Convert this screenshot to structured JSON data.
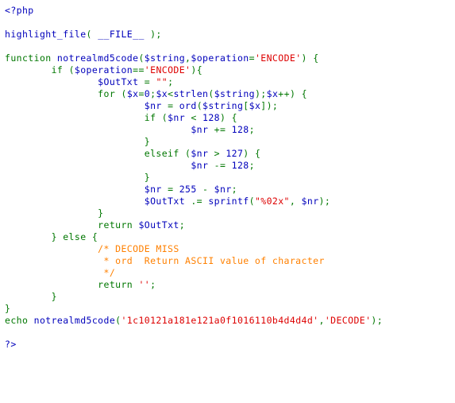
{
  "document": {
    "type": "php-source-highlight",
    "language": "PHP",
    "background_color": "#FFFFFF"
  },
  "palette": {
    "html": "#0000BB",
    "default": "#0000BB",
    "keyword": "#007700",
    "string": "#DD0000",
    "comment": "#FF8000"
  },
  "code": {
    "lines": [
      {
        "tokens": [
          {
            "t": "html",
            "s": "<?php"
          }
        ]
      },
      {
        "tokens": []
      },
      {
        "tokens": [
          {
            "t": "default",
            "s": "highlight_file"
          },
          {
            "t": "keyword",
            "s": "( "
          },
          {
            "t": "default",
            "s": "__FILE__ "
          },
          {
            "t": "keyword",
            "s": ");"
          }
        ]
      },
      {
        "tokens": []
      },
      {
        "tokens": [
          {
            "t": "keyword",
            "s": "function "
          },
          {
            "t": "default",
            "s": "notrealmd5code"
          },
          {
            "t": "keyword",
            "s": "("
          },
          {
            "t": "default",
            "s": "$string"
          },
          {
            "t": "keyword",
            "s": ","
          },
          {
            "t": "default",
            "s": "$operation"
          },
          {
            "t": "keyword",
            "s": "="
          },
          {
            "t": "string",
            "s": "'ENCODE'"
          },
          {
            "t": "keyword",
            "s": ") {"
          }
        ]
      },
      {
        "tokens": [
          {
            "t": "keyword",
            "s": "        if "
          },
          {
            "t": "keyword",
            "s": "("
          },
          {
            "t": "default",
            "s": "$operation"
          },
          {
            "t": "keyword",
            "s": "=="
          },
          {
            "t": "string",
            "s": "'ENCODE'"
          },
          {
            "t": "keyword",
            "s": "){"
          }
        ]
      },
      {
        "tokens": [
          {
            "t": "default",
            "s": "                $OutTxt "
          },
          {
            "t": "keyword",
            "s": "= "
          },
          {
            "t": "string",
            "s": "\"\""
          },
          {
            "t": "keyword",
            "s": ";"
          }
        ]
      },
      {
        "tokens": [
          {
            "t": "keyword",
            "s": "                for "
          },
          {
            "t": "keyword",
            "s": "("
          },
          {
            "t": "default",
            "s": "$x"
          },
          {
            "t": "keyword",
            "s": "="
          },
          {
            "t": "default",
            "s": "0"
          },
          {
            "t": "keyword",
            "s": ";"
          },
          {
            "t": "default",
            "s": "$x"
          },
          {
            "t": "keyword",
            "s": "<"
          },
          {
            "t": "default",
            "s": "strlen"
          },
          {
            "t": "keyword",
            "s": "("
          },
          {
            "t": "default",
            "s": "$string"
          },
          {
            "t": "keyword",
            "s": ");"
          },
          {
            "t": "default",
            "s": "$x"
          },
          {
            "t": "keyword",
            "s": "++) {"
          }
        ]
      },
      {
        "tokens": [
          {
            "t": "default",
            "s": "                        $nr "
          },
          {
            "t": "keyword",
            "s": "= "
          },
          {
            "t": "default",
            "s": "ord"
          },
          {
            "t": "keyword",
            "s": "("
          },
          {
            "t": "default",
            "s": "$string"
          },
          {
            "t": "keyword",
            "s": "["
          },
          {
            "t": "default",
            "s": "$x"
          },
          {
            "t": "keyword",
            "s": "]);"
          }
        ]
      },
      {
        "tokens": [
          {
            "t": "keyword",
            "s": "                        if "
          },
          {
            "t": "keyword",
            "s": "("
          },
          {
            "t": "default",
            "s": "$nr "
          },
          {
            "t": "keyword",
            "s": "< "
          },
          {
            "t": "default",
            "s": "128"
          },
          {
            "t": "keyword",
            "s": ") {"
          }
        ]
      },
      {
        "tokens": [
          {
            "t": "default",
            "s": "                                $nr "
          },
          {
            "t": "keyword",
            "s": "+= "
          },
          {
            "t": "default",
            "s": "128"
          },
          {
            "t": "keyword",
            "s": ";"
          }
        ]
      },
      {
        "tokens": [
          {
            "t": "keyword",
            "s": "                        }"
          }
        ]
      },
      {
        "tokens": [
          {
            "t": "keyword",
            "s": "                        elseif "
          },
          {
            "t": "keyword",
            "s": "("
          },
          {
            "t": "default",
            "s": "$nr "
          },
          {
            "t": "keyword",
            "s": "> "
          },
          {
            "t": "default",
            "s": "127"
          },
          {
            "t": "keyword",
            "s": ") {"
          }
        ]
      },
      {
        "tokens": [
          {
            "t": "default",
            "s": "                                $nr "
          },
          {
            "t": "keyword",
            "s": "-= "
          },
          {
            "t": "default",
            "s": "128"
          },
          {
            "t": "keyword",
            "s": ";"
          }
        ]
      },
      {
        "tokens": [
          {
            "t": "keyword",
            "s": "                        }"
          }
        ]
      },
      {
        "tokens": [
          {
            "t": "default",
            "s": "                        $nr "
          },
          {
            "t": "keyword",
            "s": "= "
          },
          {
            "t": "default",
            "s": "255 "
          },
          {
            "t": "keyword",
            "s": "- "
          },
          {
            "t": "default",
            "s": "$nr"
          },
          {
            "t": "keyword",
            "s": ";"
          }
        ]
      },
      {
        "tokens": [
          {
            "t": "default",
            "s": "                        $OutTxt "
          },
          {
            "t": "keyword",
            "s": ".= "
          },
          {
            "t": "default",
            "s": "sprintf"
          },
          {
            "t": "keyword",
            "s": "("
          },
          {
            "t": "string",
            "s": "\"%02x\""
          },
          {
            "t": "keyword",
            "s": ", "
          },
          {
            "t": "default",
            "s": "$nr"
          },
          {
            "t": "keyword",
            "s": ");"
          }
        ]
      },
      {
        "tokens": [
          {
            "t": "keyword",
            "s": "                }"
          }
        ]
      },
      {
        "tokens": [
          {
            "t": "keyword",
            "s": "                return "
          },
          {
            "t": "default",
            "s": "$OutTxt"
          },
          {
            "t": "keyword",
            "s": ";"
          }
        ]
      },
      {
        "tokens": [
          {
            "t": "keyword",
            "s": "        } else {"
          }
        ]
      },
      {
        "tokens": [
          {
            "t": "comment",
            "s": "                /* DECODE MISS"
          }
        ]
      },
      {
        "tokens": [
          {
            "t": "comment",
            "s": "                 * ord  Return ASCII value of character"
          }
        ]
      },
      {
        "tokens": [
          {
            "t": "comment",
            "s": "                 */"
          }
        ]
      },
      {
        "tokens": [
          {
            "t": "keyword",
            "s": "                return "
          },
          {
            "t": "string",
            "s": "''"
          },
          {
            "t": "keyword",
            "s": ";"
          }
        ]
      },
      {
        "tokens": [
          {
            "t": "keyword",
            "s": "        }"
          }
        ]
      },
      {
        "tokens": [
          {
            "t": "keyword",
            "s": "}"
          }
        ]
      },
      {
        "tokens": [
          {
            "t": "keyword",
            "s": "echo "
          },
          {
            "t": "default",
            "s": "notrealmd5code"
          },
          {
            "t": "keyword",
            "s": "("
          },
          {
            "t": "string",
            "s": "'1c10121a181e121a0f1016110b4d4d4d'"
          },
          {
            "t": "keyword",
            "s": ","
          },
          {
            "t": "string",
            "s": "'DECODE'"
          },
          {
            "t": "keyword",
            "s": ");"
          }
        ]
      },
      {
        "tokens": []
      },
      {
        "tokens": [
          {
            "t": "html",
            "s": "?>"
          }
        ]
      }
    ]
  }
}
